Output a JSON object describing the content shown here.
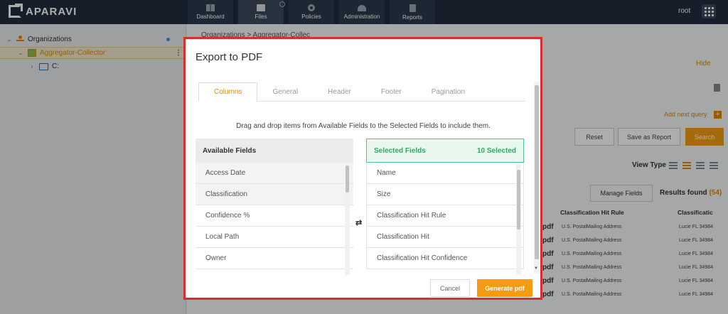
{
  "app": {
    "logo_text": "APARAVI",
    "user": "root"
  },
  "nav": [
    {
      "label": "Dashboard",
      "icon": "dashboard-icon"
    },
    {
      "label": "Files",
      "icon": "folder-icon"
    },
    {
      "label": "Policies",
      "icon": "gear-icon"
    },
    {
      "label": "Administration",
      "icon": "users-icon"
    },
    {
      "label": "Reports",
      "icon": "report-icon"
    }
  ],
  "sidebar": {
    "items": [
      {
        "label": "Organizations"
      },
      {
        "label": "Aggregator-Collector"
      },
      {
        "label": "C:"
      }
    ]
  },
  "background": {
    "breadcrumb": "Organizations  >  Aggregator-Collec",
    "hide_label": "Hide",
    "add_query_label": "Add next query",
    "reset_label": "Reset",
    "save_report_label": "Save as Report",
    "search_label": "Search",
    "view_type_label": "View Type",
    "manage_fields_label": "Manage Fields",
    "results_label": "Results found",
    "results_count": "(54)",
    "col_hit_rule": "Classification Hit Rule",
    "col_classification": "Classificatic",
    "row_ext": "pdf",
    "row_hit_rule": "U.S. PostalMailing Address",
    "row_classification": "Lucie FL 34984"
  },
  "modal": {
    "title": "Export to PDF",
    "tabs": [
      {
        "label": "Columns"
      },
      {
        "label": "General"
      },
      {
        "label": "Header"
      },
      {
        "label": "Footer"
      },
      {
        "label": "Pagination"
      }
    ],
    "instructions": "Drag and drop items from Available Fields to the Selected Fields to include them.",
    "available": {
      "title": "Available Fields",
      "items": [
        "Access Date",
        "Classification",
        "Confidence %",
        "Local Path",
        "Owner"
      ]
    },
    "selected": {
      "title": "Selected Fields",
      "count_label": "10 Selected",
      "items": [
        "Name",
        "Size",
        "Classification Hit Rule",
        "Classification Hit",
        "Classification Hit Confidence"
      ]
    },
    "cancel_label": "Cancel",
    "generate_label": "Generate pdf"
  }
}
